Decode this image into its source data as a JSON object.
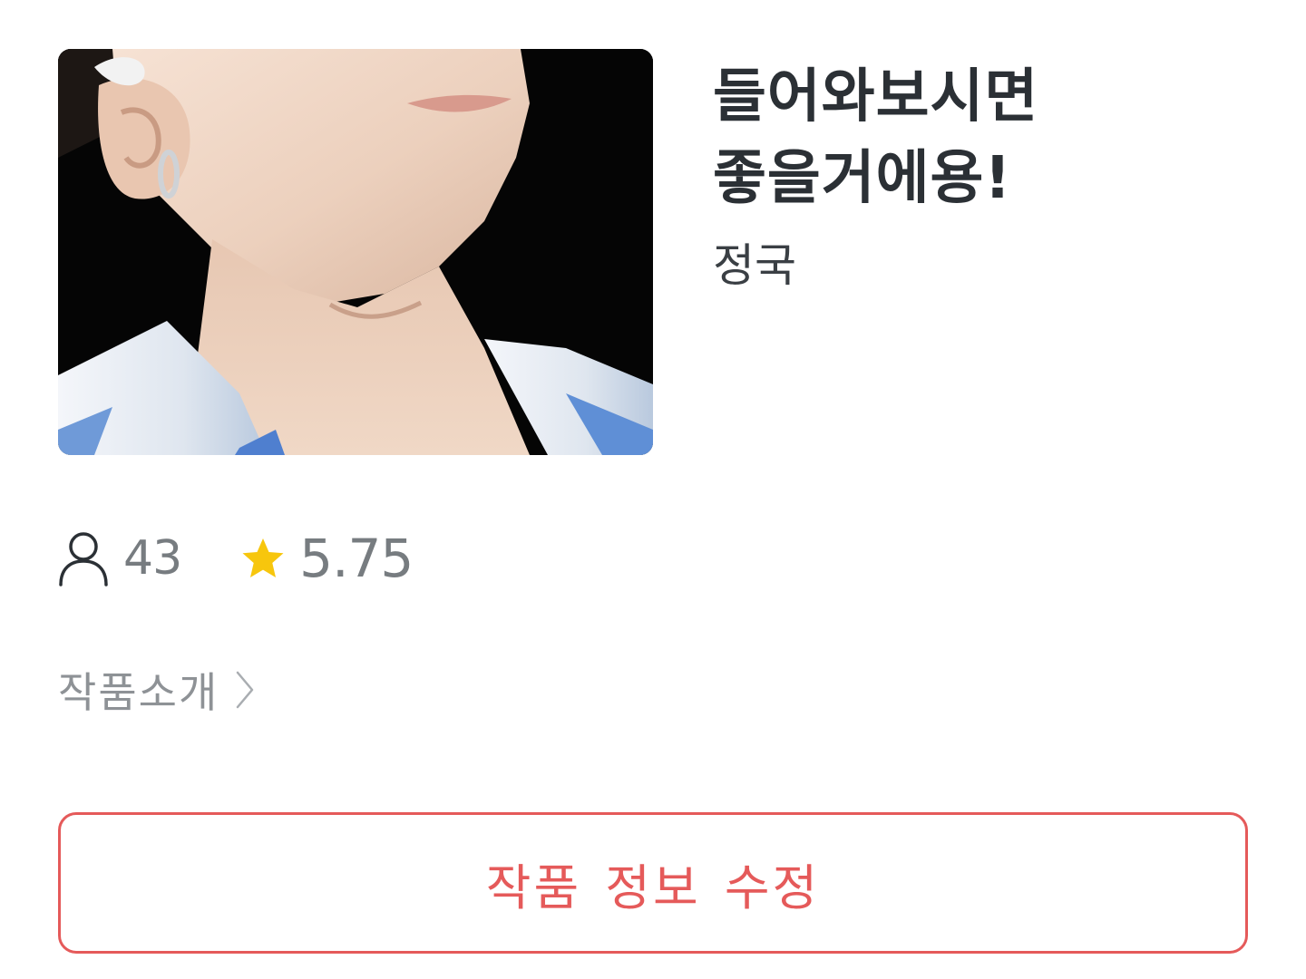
{
  "work": {
    "title_line1": "들어와보시면",
    "title_line2": "좋을거에용!",
    "author": "정국",
    "cover_icon": "cover-image"
  },
  "stats": {
    "readers_icon": "person-icon",
    "readers": "43",
    "rating_icon": "star-icon",
    "rating": "5.75",
    "star_color": "#f7c60d"
  },
  "intro": {
    "label": "작품소개",
    "icon": "chevron-right-icon"
  },
  "edit_button": {
    "label": "작품 정보 수정",
    "color": "#e55a5a"
  },
  "colors": {
    "title": "#2b3035",
    "muted": "#777c80",
    "accent": "#e55a5a"
  }
}
